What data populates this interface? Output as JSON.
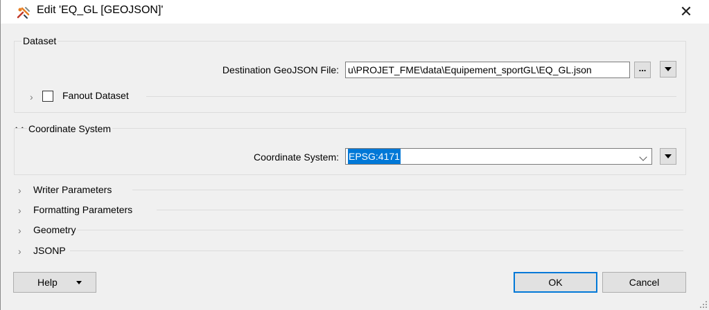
{
  "window": {
    "title": "Edit 'EQ_GL [GEOJSON]'",
    "close_glyph": "✕"
  },
  "dataset": {
    "legend": "Dataset",
    "destination_label": "Destination GeoJSON File:",
    "destination_value": "u\\PROJET_FME\\data\\Equipement_sportGL\\EQ_GL.json",
    "browse_label": "...",
    "fanout_label": "Fanout Dataset",
    "fanout_checked": false
  },
  "coordinate_system": {
    "header": "Coordinate System",
    "label": "Coordinate System:",
    "value": "EPSG:4171"
  },
  "sections": [
    {
      "label": "Writer Parameters"
    },
    {
      "label": "Formatting Parameters"
    },
    {
      "label": "Geometry"
    },
    {
      "label": "JSONP"
    }
  ],
  "footer": {
    "help_label": "Help",
    "ok_label": "OK",
    "cancel_label": "Cancel"
  },
  "colors": {
    "accent": "#0078d7",
    "dialog_bg": "#f0f0f0"
  },
  "icons": {
    "app": "fme-transformer-icon",
    "chevron_collapsed": "chevron-right-icon",
    "chevron_expanded": "chevron-down-icon"
  }
}
